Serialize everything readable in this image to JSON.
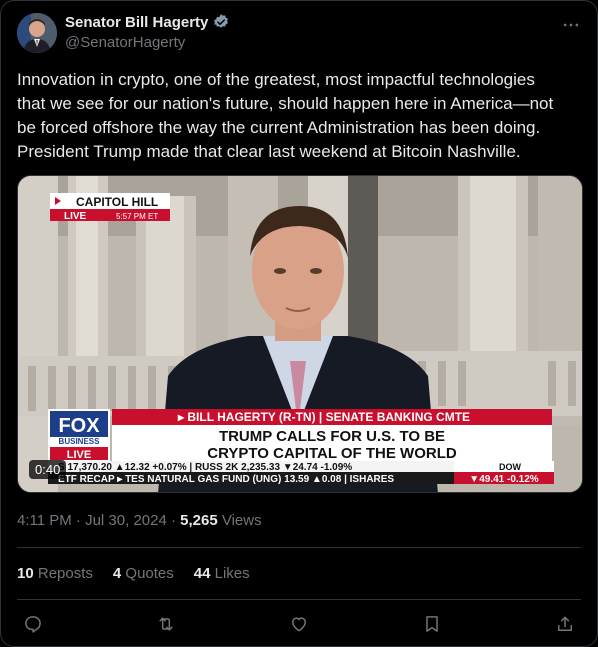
{
  "author": {
    "name": "Senator Bill Hagerty",
    "handle": "@SenatorHagerty",
    "verified_icon": "verified-badge-icon"
  },
  "tweet": {
    "lines": [
      "Innovation in crypto, one of the greatest, most impactful technologies",
      "that we see for our nation's future, should happen here in America—not",
      "be forced offshore the way the current Administration has been doing.",
      "President Trump made that clear last weekend at Bitcoin Nashville."
    ]
  },
  "video": {
    "duration": "0:40",
    "location_tag": "CAPITOL HILL",
    "live_tag": "LIVE",
    "live_time": "5:57 PM ET",
    "network_logo_top": "FOX",
    "network_logo_bottom": "BUSINESS",
    "network_live": "LIVE",
    "name_strip": "▸ BILL HAGERTY (R-TN) | SENATE BANKING CMTE",
    "headline_1": "TRUMP CALLS FOR U.S. TO BE",
    "headline_2": "CRYPTO CAPITAL OF THE WORLD",
    "ticker_1": "S    17,370.20 ▲12.32 +0.07% | RUSS 2K   2,235.33 ▼24.74 -1.09%",
    "ticker_dow_label": "DOW",
    "ticker_2": "ETF RECAP  ▸ TES NATURAL GAS FUND (UNG)  13.59 ▲0.08 | ISHARES",
    "ticker_dow_value": "▼49.41  -0.12%"
  },
  "meta": {
    "time": "4:11 PM · Jul 30, 2024 · ",
    "views_count": "5,265",
    "views_label": " Views"
  },
  "stats": {
    "reposts_count": "10",
    "reposts_label": " Reposts",
    "quotes_count": "4",
    "quotes_label": " Quotes",
    "likes_count": "44",
    "likes_label": " Likes"
  },
  "colors": {
    "background": "#000000",
    "text": "#e7e9ea",
    "muted": "#71767b",
    "verified": "#829aab",
    "fox_red": "#c8102e",
    "fox_blue": "#1d3f8a"
  }
}
